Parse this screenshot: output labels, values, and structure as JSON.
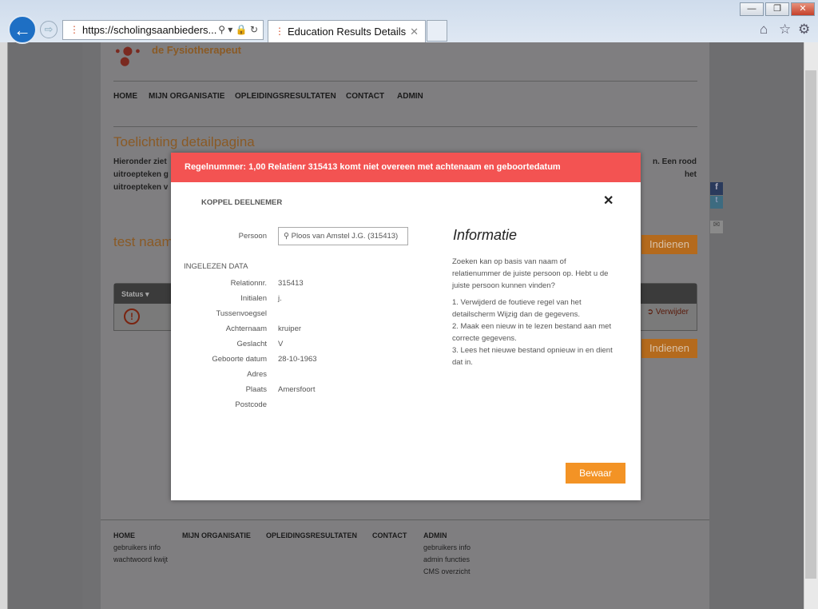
{
  "browser": {
    "url": "https://scholingsaanbieders...",
    "tab_title": "Education Results Details",
    "window_buttons": [
      "minimize",
      "restore",
      "close"
    ]
  },
  "site": {
    "logo": "de Fysiotherapeut",
    "nav": [
      "HOME",
      "MIJN ORGANISATIE",
      "OPLEIDINGSRESULTATEN",
      "CONTACT",
      "ADMIN"
    ]
  },
  "page": {
    "title": "Toelichting detailpagina",
    "intro_lines": [
      "Hieronder ziet",
      "uitroepteken g",
      "uitroepteken v"
    ],
    "intro_right": [
      "n. Een rood",
      "het"
    ],
    "section_title": "test naam",
    "indienen": "Indienen",
    "table": {
      "status_header": "Status",
      "remove": "Verwijder"
    }
  },
  "modal": {
    "error": "Regelnummer: 1,00 Relatienr 315413 komt niet overeen met achtenaam en geboortedatum",
    "title": "KOPPEL DEELNEMER",
    "persoon_label": "Persoon",
    "persoon_value": "Ploos van Amstel J.G. (315413)",
    "section": "INGELEZEN DATA",
    "fields": [
      {
        "label": "Relationnr.",
        "value": "315413"
      },
      {
        "label": "Initialen",
        "value": "j."
      },
      {
        "label": "Tussenvoegsel",
        "value": ""
      },
      {
        "label": "Achternaam",
        "value": "kruiper"
      },
      {
        "label": "Geslacht",
        "value": "V"
      },
      {
        "label": "Geboorte datum",
        "value": "28-10-1963"
      },
      {
        "label": "Adres",
        "value": ""
      },
      {
        "label": "Plaats",
        "value": "Amersfoort"
      },
      {
        "label": "Postcode",
        "value": ""
      }
    ],
    "info_title": "Informatie",
    "info_text": "Zoeken kan op basis van naam of relatienummer de juiste persoon op. Hebt u de juiste persoon kunnen vinden?",
    "steps": [
      "1. Verwijderd de foutieve regel van het detailscherm Wijzig dan de gegevens.",
      "2. Maak een nieuw in te lezen bestand aan met correcte gegevens.",
      "3. Lees het nieuwe bestand opnieuw in en dient dat in."
    ],
    "save": "Bewaar"
  },
  "footer": {
    "cols": [
      {
        "head": "HOME",
        "links": [
          "gebruikers info",
          "wachtwoord kwijt"
        ]
      },
      {
        "head": "MIJN ORGANISATIE",
        "links": []
      },
      {
        "head": "OPLEIDINGSRESULTATEN",
        "links": []
      },
      {
        "head": "CONTACT",
        "links": []
      },
      {
        "head": "ADMIN",
        "links": [
          "gebruikers info",
          "admin functies",
          "CMS overzicht"
        ]
      }
    ]
  }
}
